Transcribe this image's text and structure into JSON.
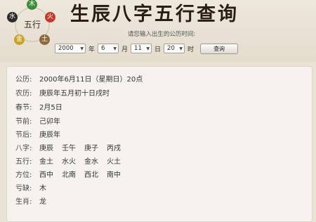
{
  "colors": {
    "wood": "#3d8b3a",
    "fire": "#c0392b",
    "earth": "#8b6b3e",
    "metal": "#c9a227",
    "water": "#2b2b2b"
  },
  "logo": {
    "center": "五行",
    "elements": [
      {
        "char": "木",
        "name": "wood"
      },
      {
        "char": "火",
        "name": "fire"
      },
      {
        "char": "土",
        "name": "earth"
      },
      {
        "char": "金",
        "name": "metal"
      },
      {
        "char": "水",
        "name": "water"
      }
    ]
  },
  "header": {
    "title": "生辰八字五行查询",
    "prompt": "请您输入出生的公历时间:"
  },
  "form": {
    "year": "2000",
    "year_unit": "年",
    "month": "6",
    "month_unit": "月",
    "day": "11",
    "day_unit": "日",
    "hour": "20",
    "hour_unit": "时",
    "submit_label": "查询"
  },
  "result": {
    "rows": [
      {
        "label": "公历:",
        "parts": [
          "2000年6月11日（星期日）20点"
        ]
      },
      {
        "label": "农历:",
        "parts": [
          "庚辰年五月初十日戌时"
        ]
      },
      {
        "label": "春节:",
        "parts": [
          "2月5日"
        ]
      },
      {
        "label": "节前:",
        "parts": [
          "己卯年"
        ]
      },
      {
        "label": "节后:",
        "parts": [
          "庚辰年"
        ]
      },
      {
        "label": "八字:",
        "parts": [
          "庚辰",
          "壬午",
          "庚子",
          "丙戌"
        ]
      },
      {
        "label": "五行:",
        "parts": [
          "金土",
          "水火",
          "金水",
          "火土"
        ]
      },
      {
        "label": "方位:",
        "parts": [
          "西中",
          "北南",
          "西北",
          "南中"
        ]
      },
      {
        "label": "亏缺:",
        "parts": [
          "木"
        ]
      },
      {
        "label": "生肖:",
        "parts": [
          "龙"
        ]
      }
    ]
  }
}
